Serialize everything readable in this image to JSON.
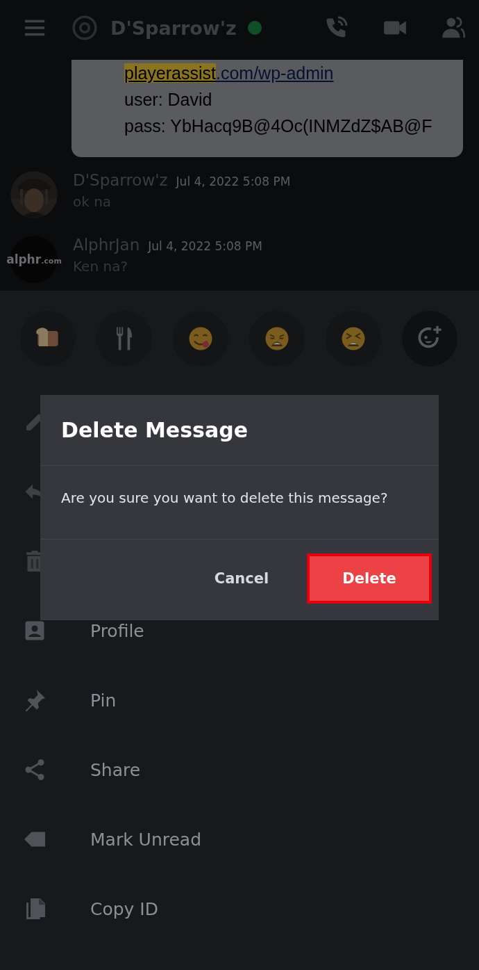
{
  "header": {
    "channel": "D'Sparrow'z",
    "online": true
  },
  "attachment": {
    "link_highlight": "playerassist",
    "link_rest": ".com/wp-admin",
    "lines": [
      "user: David",
      "pass: YbHacq9B@4Oc(INMZdZ$AB@F"
    ]
  },
  "messages": [
    {
      "author": "D'Sparrow'z",
      "time": "Jul 4, 2022 5:08 PM",
      "text": "ok na"
    },
    {
      "author": "AlphrJan",
      "time": "Jul 4, 2022 5:08 PM",
      "text": "Ken na?",
      "avatar": {
        "kind": "logo",
        "main": "alphr",
        "suffix": ".com"
      }
    }
  ],
  "reactions": [
    {
      "kind": "bread"
    },
    {
      "kind": "cutlery"
    },
    {
      "kind": "yum"
    },
    {
      "kind": "weary"
    },
    {
      "kind": "tired"
    },
    {
      "kind": "add"
    }
  ],
  "menu": [
    {
      "kind": "edit"
    },
    {
      "kind": "reply"
    },
    {
      "kind": "delete"
    },
    {
      "kind": "profile",
      "label": "Profile"
    },
    {
      "kind": "pin",
      "label": "Pin"
    },
    {
      "kind": "share",
      "label": "Share"
    },
    {
      "kind": "unread",
      "label": "Mark Unread"
    },
    {
      "kind": "copy",
      "label": "Copy ID"
    }
  ],
  "dialog": {
    "title": "Delete Message",
    "message": "Are you sure you want to delete this message?",
    "buttons": [
      {
        "label": "Cancel",
        "kind": "secondary",
        "highlighted": false
      },
      {
        "label": "Delete",
        "kind": "danger",
        "highlighted": true
      }
    ]
  }
}
